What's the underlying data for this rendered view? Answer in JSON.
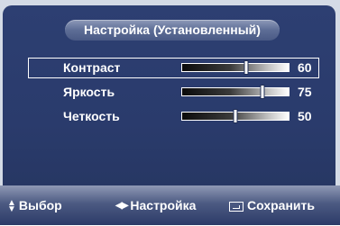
{
  "menu": {
    "title": "Настройка (Установленный)",
    "items": [
      {
        "label": "Контраст",
        "value": "60",
        "level": 0.6,
        "selected": true
      },
      {
        "label": "Яркость",
        "value": "75",
        "level": 0.75,
        "selected": false
      },
      {
        "label": "Четкость",
        "value": "50",
        "level": 0.5,
        "selected": false
      }
    ]
  },
  "footer": {
    "select_label": "Выбор",
    "adjust_label": "Настройка",
    "save_label": "Сохранить",
    "select_icon": "up-down-arrows-icon",
    "adjust_icon": "left-right-arrows-icon",
    "save_icon": "enter-icon"
  },
  "colors": {
    "panel_background": "#2a3b6c",
    "title_pill": "#5d6d96",
    "text": "#ffffff"
  }
}
